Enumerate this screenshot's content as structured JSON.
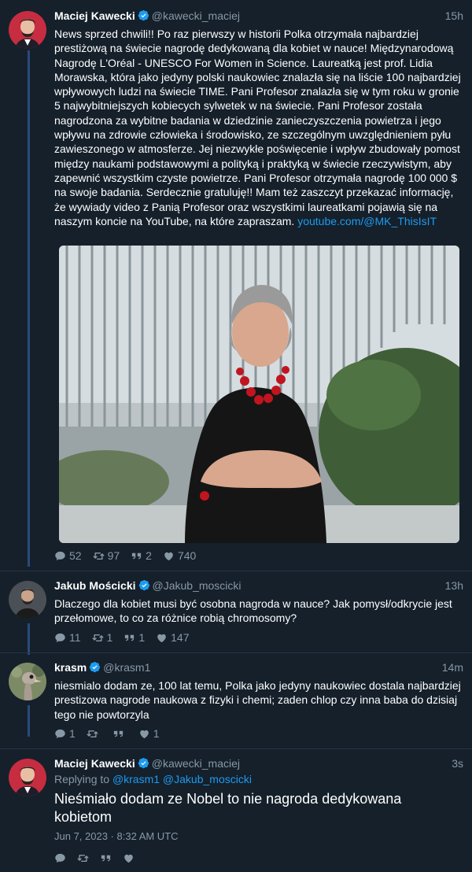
{
  "tweets": [
    {
      "name": "Maciej Kawecki",
      "handle": "@kawecki_maciej",
      "time": "15h",
      "text": "News sprzed chwili!! Po raz pierwszy w historii Polka otrzymała najbardziej prestiżową na świecie nagrodę dedykowaną dla kobiet w nauce! Międzynarodową Nagrodę L'Oréal - UNESCO For Women in Science. Laureatką jest prof. Lidia Morawska, która jako jedyny polski naukowiec znalazła się na liście 100 najbardziej wpływowych ludzi na świecie TIME. Pani Profesor znalazła się w tym roku w gronie 5 najwybitniejszych kobiecych sylwetek w na świecie. Pani Profesor została nagrodzona za wybitne badania w dziedzinie zanieczyszczenia powietrza i jego wpływu na zdrowie człowieka i środowisko, ze szczególnym uwzględnieniem pyłu zawieszonego w atmosferze. Jej niezwykłe poświęcenie i wpływ zbudowały pomost między naukami podstawowymi a polityką i praktyką w świecie rzeczywistym, aby zapewnić wszystkim czyste powietrze. Pani Profesor otrzymała nagrodę 100 000 $ na swoje badania. Serdecznie gratuluję!! Mam też zaszczyt przekazać informację, że wywiady video z Panią Profesor oraz wszystkimi laureatkami pojawią się na naszym koncie na YouTube, na które zapraszam. ",
      "link": "youtube.com/@MK_ThisIsIT",
      "replies": "52",
      "retweets": "97",
      "quotes": "2",
      "likes": "740"
    },
    {
      "name": "Jakub Mościcki",
      "handle": "@Jakub_moscicki",
      "time": "13h",
      "text": "Dlaczego dla kobiet musi być osobna nagroda w nauce? Jak pomysł/odkrycie jest przełomowe, to co za różnice robią chromosomy?",
      "replies": "11",
      "retweets": "1",
      "quotes": "1",
      "likes": "147"
    },
    {
      "name": "krasm",
      "handle": "@krasm1",
      "time": "14m",
      "text": "niesmialo dodam ze, 100 lat temu, Polka jako jedyny naukowiec dostala najbardziej prestizowa nagrode naukowa z fizyki i chemi; zaden chlop czy inna baba do dzisiaj tego nie powtorzyla",
      "replies": "1",
      "retweets": "",
      "quotes": "",
      "likes": "1"
    },
    {
      "name": "Maciej Kawecki",
      "handle": "@kawecki_maciej",
      "time": "3s",
      "replying_label": "Replying to",
      "replying_to": "@krasm1 @Jakub_moscicki",
      "text": "Nieśmiało dodam ze Nobel to nie nagroda dedykowana kobietom",
      "date": "Jun 7, 2023 · 8:32 AM UTC"
    }
  ],
  "colors": {
    "background": "#15202b",
    "link": "#1d9bf0",
    "muted": "#8899a6",
    "verified": "#1d9bf0",
    "thread": "#2b4a7a"
  }
}
